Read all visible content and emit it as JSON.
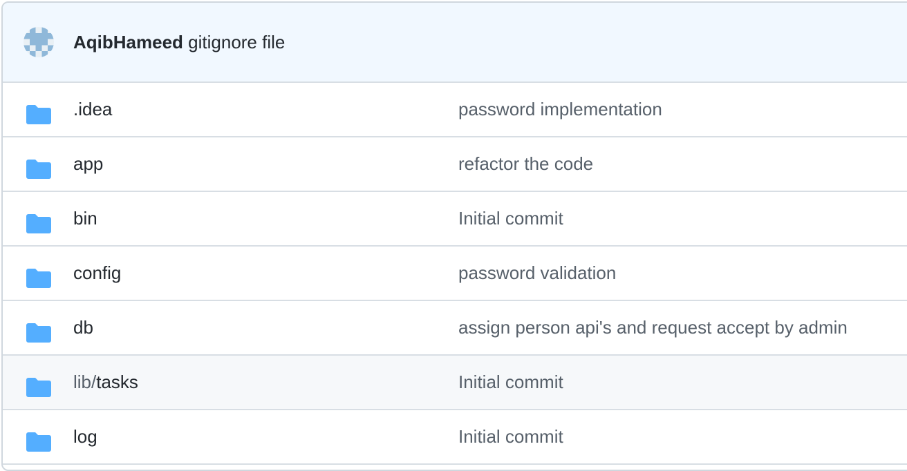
{
  "latest_commit": {
    "author": "AqibHameed",
    "message": "gitignore file",
    "avatar_icon": "identicon-avatar"
  },
  "files": [
    {
      "prefix": "",
      "name": ".idea",
      "type": "folder",
      "commit_message": "password implementation"
    },
    {
      "prefix": "",
      "name": "app",
      "type": "folder",
      "commit_message": "refactor the code"
    },
    {
      "prefix": "",
      "name": "bin",
      "type": "folder",
      "commit_message": "Initial commit"
    },
    {
      "prefix": "",
      "name": "config",
      "type": "folder",
      "commit_message": "password validation"
    },
    {
      "prefix": "",
      "name": "db",
      "type": "folder",
      "commit_message": "assign person api's and request accept by admin"
    },
    {
      "prefix": "lib/",
      "name": "tasks",
      "type": "folder",
      "commit_message": "Initial commit",
      "hovered": true
    },
    {
      "prefix": "",
      "name": "log",
      "type": "folder",
      "commit_message": "Initial commit"
    }
  ],
  "colors": {
    "folder": "#54aeff",
    "header_bg": "#f1f8ff",
    "hover_bg": "#f6f8fa"
  }
}
